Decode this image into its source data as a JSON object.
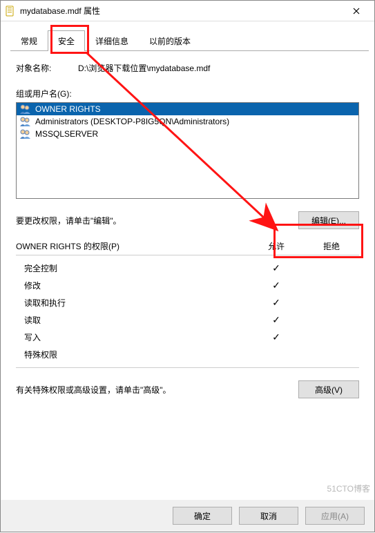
{
  "titlebar": {
    "title": "mydatabase.mdf 属性"
  },
  "tabs": {
    "items": [
      {
        "label": "常规"
      },
      {
        "label": "安全"
      },
      {
        "label": "详细信息"
      },
      {
        "label": "以前的版本"
      }
    ],
    "active_index": 1
  },
  "object": {
    "label": "对象名称:",
    "value": "D:\\浏览器下载位置\\mydatabase.mdf"
  },
  "groups": {
    "label": "组或用户名(G):",
    "list": [
      {
        "name": "OWNER RIGHTS",
        "selected": true
      },
      {
        "name": "Administrators (DESKTOP-P8IG5QN\\Administrators)",
        "selected": false
      },
      {
        "name": "MSSQLSERVER",
        "selected": false
      }
    ]
  },
  "edit": {
    "hint": "要更改权限，请单击\"编辑\"。",
    "button": "编辑(E)..."
  },
  "permissions": {
    "header": "OWNER RIGHTS 的权限(P)",
    "allow_label": "允许",
    "deny_label": "拒绝",
    "rows": [
      {
        "name": "完全控制",
        "allow": true,
        "deny": false
      },
      {
        "name": "修改",
        "allow": true,
        "deny": false
      },
      {
        "name": "读取和执行",
        "allow": true,
        "deny": false
      },
      {
        "name": "读取",
        "allow": true,
        "deny": false
      },
      {
        "name": "写入",
        "allow": true,
        "deny": false
      },
      {
        "name": "特殊权限",
        "allow": false,
        "deny": false
      }
    ]
  },
  "advanced": {
    "hint": "有关特殊权限或高级设置，请单击\"高级\"。",
    "button": "高级(V)"
  },
  "buttons": {
    "ok": "确定",
    "cancel": "取消",
    "apply": "应用(A)"
  },
  "watermark": "51CTO博客",
  "annotations": {
    "accent": "#ff1414"
  }
}
